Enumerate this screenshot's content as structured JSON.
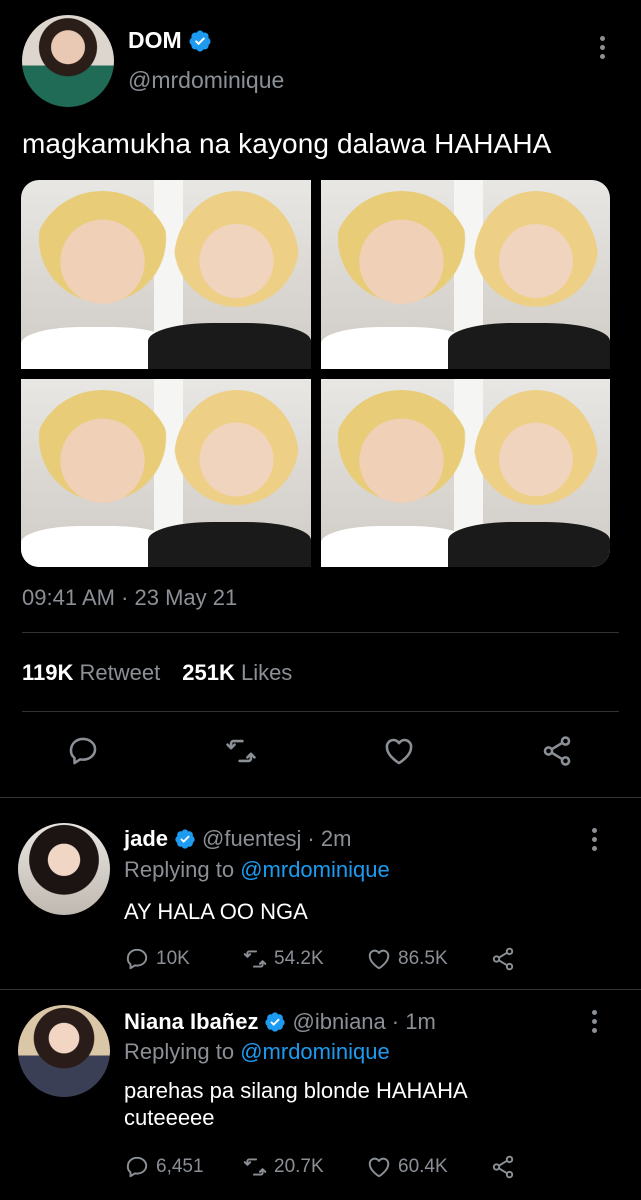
{
  "tweet": {
    "author_name": "DOM",
    "author_handle": "@mrdominique",
    "text": "magkamukha na kayong dalawa HAHAHA",
    "timestamp": "09:41 AM · 23 May 21",
    "retweet_count": "119K",
    "retweet_label": "Retweet",
    "like_count": "251K",
    "like_label": "Likes",
    "photo_count": 4
  },
  "replies": [
    {
      "name": "jade",
      "handle": "@fuentesj",
      "time": "· 2m",
      "replying_prefix": "Replying to",
      "replying_to": "@mrdominique",
      "text": "AY HALA OO NGA",
      "reply_count": "10K",
      "retweet_count": "54.2K",
      "like_count": "86.5K"
    },
    {
      "name": "Niana Ibañez",
      "handle": "@ibniana",
      "time": "· 1m",
      "replying_prefix": "Replying to",
      "replying_to": "@mrdominique",
      "text_line1": "parehas pa silang blonde HAHAHA",
      "text_line2": "cuteeeee",
      "reply_count": "6,451",
      "retweet_count": "20.7K",
      "like_count": "60.4K"
    }
  ],
  "icons": {
    "verified": "verified-badge-icon",
    "reply": "reply-icon",
    "retweet": "retweet-icon",
    "like": "heart-icon",
    "share": "share-icon",
    "more": "more-vertical-icon"
  },
  "colors": {
    "background": "#000000",
    "text": "#ffffff",
    "muted": "#8b9096",
    "link": "#1d9bf0",
    "divider": "#2f3336"
  }
}
